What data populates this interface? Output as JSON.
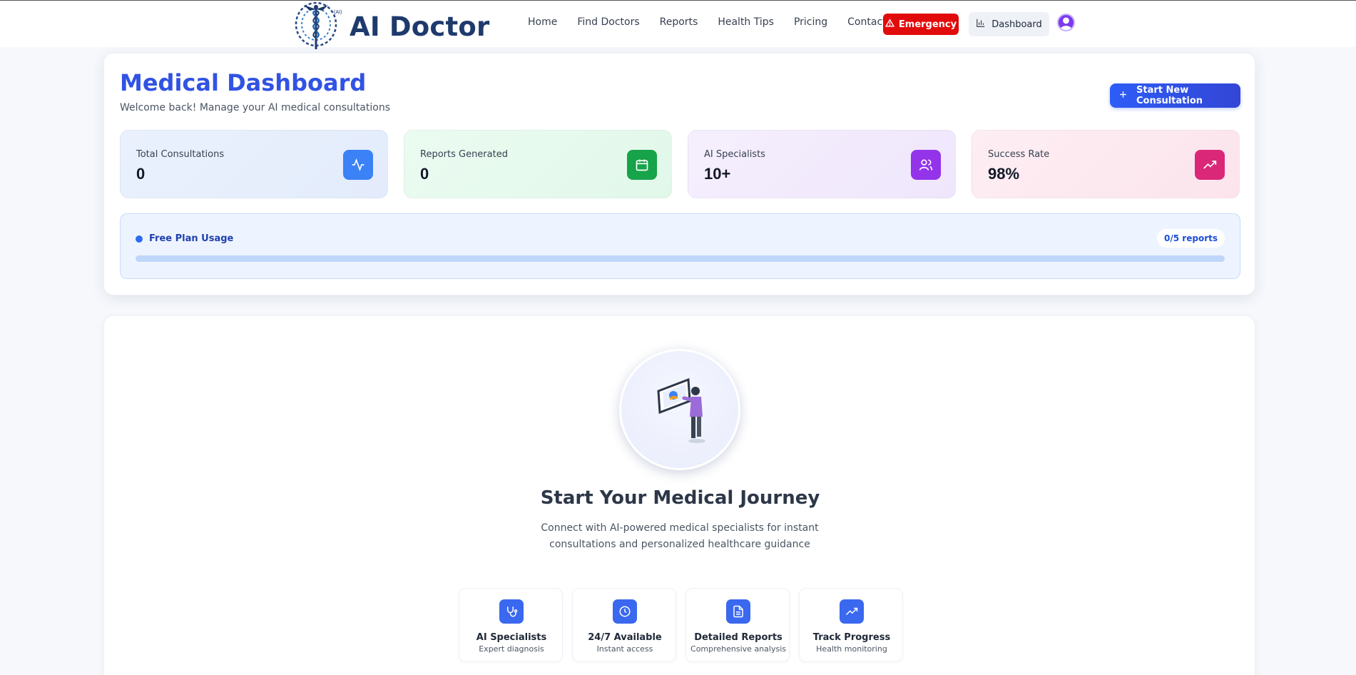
{
  "brand": {
    "name": "AI Doctor",
    "badge": "(AI)"
  },
  "nav": [
    "Home",
    "Find Doctors",
    "Reports",
    "Health Tips",
    "Pricing",
    "Contact"
  ],
  "header_actions": {
    "emergency": "Emergency",
    "dashboard": "Dashboard"
  },
  "page": {
    "title": "Medical Dashboard",
    "subtitle": "Welcome back! Manage your AI medical consultations",
    "new_consultation": "Start New Consultation"
  },
  "stats": [
    {
      "label": "Total Consultations",
      "value": "0",
      "icon": "activity-icon",
      "color": "#3b82f6"
    },
    {
      "label": "Reports Generated",
      "value": "0",
      "icon": "calendar-icon",
      "color": "#16a34a"
    },
    {
      "label": "AI Specialists",
      "value": "10+",
      "icon": "users-icon",
      "color": "#9333ea"
    },
    {
      "label": "Success Rate",
      "value": "98%",
      "icon": "trending-up-icon",
      "color": "#db2777"
    }
  ],
  "usage": {
    "label": "Free Plan Usage",
    "count": "0/5 reports",
    "used": 0,
    "total": 5
  },
  "journey": {
    "title": "Start Your Medical Journey",
    "description": "Connect with AI-powered medical specialists for instant consultations and personalized healthcare guidance"
  },
  "features": [
    {
      "title": "AI Specialists",
      "subtitle": "Expert diagnosis",
      "icon": "stethoscope-icon"
    },
    {
      "title": "24/7 Available",
      "subtitle": "Instant access",
      "icon": "clock-icon"
    },
    {
      "title": "Detailed Reports",
      "subtitle": "Comprehensive analysis",
      "icon": "file-text-icon"
    },
    {
      "title": "Track Progress",
      "subtitle": "Health monitoring",
      "icon": "trending-up-icon"
    }
  ]
}
